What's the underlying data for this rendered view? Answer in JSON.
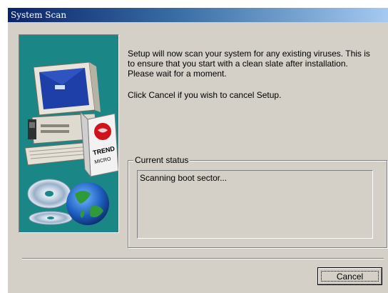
{
  "window": {
    "title": "System Scan"
  },
  "sidebar_image": {
    "description_icon": "computer-with-trend-micro-box-icon",
    "brand_text": "TREND MICRO"
  },
  "intro": {
    "line1": "Setup will now scan your system for any existing viruses. This is",
    "line2": "to ensure that you start with a clean slate after installation.",
    "line3": "Please wait for a moment."
  },
  "cancel_note": "Click Cancel if you wish to cancel Setup.",
  "status": {
    "group_label": "Current status",
    "text": "Scanning boot sector..."
  },
  "buttons": {
    "cancel_label": "Cancel"
  },
  "colors": {
    "titlebar_start": "#0a246a",
    "titlebar_end": "#a6caf0",
    "dialog_bg": "#d4d0c8",
    "panel_bg": "#1b8686"
  }
}
